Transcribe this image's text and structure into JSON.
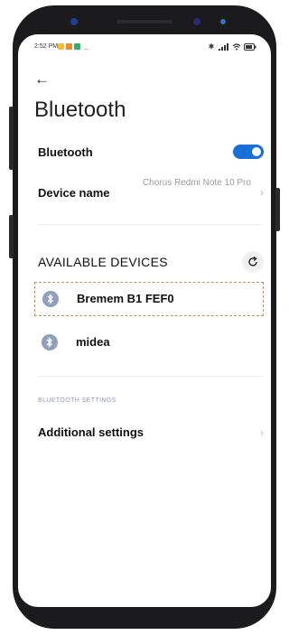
{
  "status_bar": {
    "time": "2:52 PM",
    "dots": "...",
    "right_icons": "✱ ᴺᴵᴸ ≡ ▭",
    "app_icon_colors": [
      "#f2c030",
      "#f08a3a",
      "#2fb36a"
    ]
  },
  "header": {
    "back_icon": "←",
    "title": "Bluetooth"
  },
  "bluetooth": {
    "label": "Bluetooth",
    "enabled": true,
    "toggle_color": "#1a6fd6"
  },
  "device_name": {
    "label": "Device name",
    "value": "Chorus Redmi Note 10 Pro",
    "chevron": "›"
  },
  "available": {
    "label": "AVAILABLE DEVICES",
    "devices": [
      {
        "name": "Bremem B1 FEF0",
        "selected": true
      },
      {
        "name": "midea",
        "selected": false
      }
    ]
  },
  "settings": {
    "section_label": "BLUETOOTH SETTINGS",
    "additional_label": "Additional settings",
    "chevron": "›"
  }
}
